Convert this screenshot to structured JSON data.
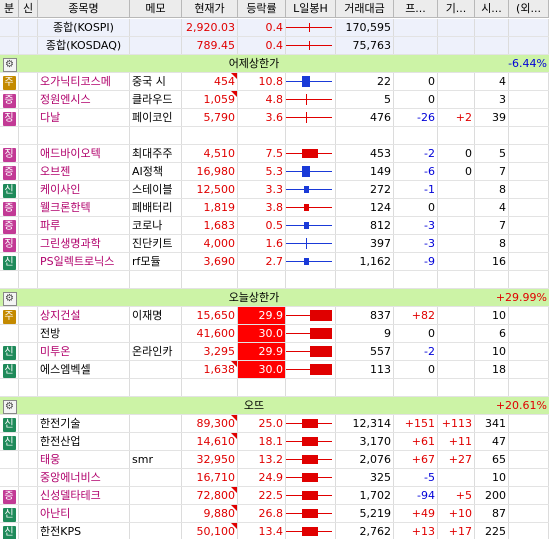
{
  "headers": [
    "분",
    "신",
    "종목명",
    "메모",
    "현재가",
    "등락률",
    "L일봉H",
    "거래대금",
    "프...",
    "기...",
    "시...",
    "(외..."
  ],
  "rows": [
    {
      "kind": "index",
      "name": "종합(KOSPI)",
      "price": "2,920.03",
      "rate": "0.4",
      "value": "170,595",
      "candle": {
        "body": "none",
        "wick": "red"
      }
    },
    {
      "kind": "index",
      "name": "종합(KOSDAQ)",
      "price": "789.45",
      "rate": "0.4",
      "value": "75,763",
      "candle": {
        "body": "none",
        "wick": "red"
      }
    },
    {
      "kind": "section",
      "title": "어제상한가",
      "change": "-6.44%",
      "change_color": "blue"
    },
    {
      "kind": "stock",
      "badge": "주",
      "name": "오가닉티코스메",
      "name_color": "pur",
      "memo": "중국 시",
      "price": "454",
      "rate": "10.8",
      "value": "22",
      "pro": "0",
      "gi": "",
      "si": "4",
      "flag": true,
      "candle": {
        "body": "blue",
        "wick": "blue"
      }
    },
    {
      "kind": "stock",
      "badge": "증",
      "name": "정원엔시스",
      "name_color": "pur",
      "memo": "클라우드",
      "price": "1,059",
      "rate": "4.8",
      "value": "5",
      "pro": "0",
      "gi": "",
      "si": "3",
      "flag": true,
      "candle": {
        "body": "tick",
        "wick": "red"
      }
    },
    {
      "kind": "stock",
      "badge": "징",
      "name": "다날",
      "name_color": "pur",
      "memo": "페이코인",
      "price": "5,790",
      "rate": "3.6",
      "value": "476",
      "pro": "-26",
      "gi": "+2",
      "si": "39",
      "flag": false,
      "candle": {
        "body": "tick",
        "wick": "red"
      }
    },
    {
      "kind": "blank"
    },
    {
      "kind": "stock",
      "badge": "징",
      "name": "애드바이오텍",
      "name_color": "pur",
      "memo": "최대주주",
      "price": "4,510",
      "rate": "7.5",
      "value": "453",
      "pro": "-2",
      "gi": "0",
      "si": "5",
      "flag": false,
      "candle": {
        "body": "red-long",
        "wick": "red"
      }
    },
    {
      "kind": "stock",
      "badge": "증",
      "name": "오브젠",
      "name_color": "pur",
      "memo": "AI정책",
      "price": "16,980",
      "rate": "5.3",
      "value": "149",
      "pro": "-6",
      "gi": "0",
      "si": "7",
      "flag": false,
      "candle": {
        "body": "blue",
        "wick": "blue"
      }
    },
    {
      "kind": "stock",
      "badge": "신",
      "name": "케이사인",
      "name_color": "pur",
      "memo": "스테이블",
      "price": "12,500",
      "rate": "3.3",
      "value": "272",
      "pro": "-1",
      "gi": "",
      "si": "8",
      "flag": false,
      "candle": {
        "body": "blue-small",
        "wick": "blue"
      }
    },
    {
      "kind": "stock",
      "badge": "증",
      "name": "웰크론한텍",
      "name_color": "pur",
      "memo": "페배터리",
      "price": "1,819",
      "rate": "3.8",
      "value": "124",
      "pro": "0",
      "gi": "",
      "si": "4",
      "flag": false,
      "candle": {
        "body": "red-small",
        "wick": "red"
      }
    },
    {
      "kind": "stock",
      "badge": "증",
      "name": "파루",
      "name_color": "pur",
      "memo": "코로나",
      "price": "1,683",
      "rate": "0.5",
      "value": "812",
      "pro": "-3",
      "gi": "",
      "si": "7",
      "flag": false,
      "candle": {
        "body": "blue-small",
        "wick": "blue"
      }
    },
    {
      "kind": "stock",
      "badge": "징",
      "name": "그린생명과학",
      "name_color": "pur",
      "memo": "진단키트",
      "price": "4,000",
      "rate": "1.6",
      "value": "397",
      "pro": "-3",
      "gi": "",
      "si": "8",
      "flag": false,
      "candle": {
        "body": "tick",
        "wick": "blue"
      }
    },
    {
      "kind": "stock",
      "badge": "신",
      "name": "PS일렉트로닉스",
      "name_color": "pur",
      "memo": "rf모듈",
      "price": "3,690",
      "rate": "2.7",
      "value": "1,162",
      "pro": "-9",
      "gi": "",
      "si": "16",
      "flag": false,
      "candle": {
        "body": "blue-small",
        "wick": "blue"
      }
    },
    {
      "kind": "blank"
    },
    {
      "kind": "section",
      "title": "오늘상한가",
      "change": "+29.99%",
      "change_color": "red"
    },
    {
      "kind": "stock",
      "badge": "주",
      "name": "상지건설",
      "name_color": "pur",
      "memo": "이재명",
      "price": "15,650",
      "rate": "29.9",
      "rate_hl": true,
      "value": "837",
      "pro": "+82",
      "gi": "",
      "si": "10",
      "flag": false,
      "candle": {
        "body": "red-full",
        "wick": "red"
      }
    },
    {
      "kind": "stock",
      "badge": "",
      "name": "전방",
      "name_color": "blk",
      "memo": "",
      "price": "41,600",
      "rate": "30.0",
      "rate_hl": true,
      "value": "9",
      "pro": "0",
      "gi": "",
      "si": "6",
      "flag": false,
      "candle": {
        "body": "red-full",
        "wick": "red"
      }
    },
    {
      "kind": "stock",
      "badge": "신",
      "name": "미투온",
      "name_color": "pur",
      "memo": "온라인카",
      "price": "3,295",
      "rate": "29.9",
      "rate_hl": true,
      "value": "557",
      "pro": "-2",
      "gi": "",
      "si": "10",
      "flag": false,
      "candle": {
        "body": "red-full",
        "wick": "red"
      }
    },
    {
      "kind": "stock",
      "badge": "신",
      "name": "에스엠벡셀",
      "name_color": "blk",
      "memo": "",
      "price": "1,638",
      "rate": "30.0",
      "rate_hl": true,
      "value": "113",
      "pro": "0",
      "gi": "",
      "si": "18",
      "flag": true,
      "candle": {
        "body": "red-full",
        "wick": "red"
      }
    },
    {
      "kind": "blank"
    },
    {
      "kind": "section",
      "title": "오뜨",
      "change": "+20.61%",
      "change_color": "red"
    },
    {
      "kind": "stock",
      "badge": "신",
      "name": "한전기술",
      "name_color": "blk",
      "memo": "",
      "price": "89,300",
      "rate": "25.0",
      "value": "12,314",
      "pro": "+151",
      "gi": "+113",
      "si": "341",
      "flag": true,
      "candle": {
        "body": "red-long",
        "wick": "red"
      }
    },
    {
      "kind": "stock",
      "badge": "신",
      "name": "한전산업",
      "name_color": "blk",
      "memo": "",
      "price": "14,610",
      "rate": "18.1",
      "value": "3,170",
      "pro": "+61",
      "gi": "+11",
      "si": "47",
      "flag": true,
      "candle": {
        "body": "red-long",
        "wick": "red"
      }
    },
    {
      "kind": "stock",
      "badge": "",
      "name": "태웅",
      "name_color": "pur",
      "memo": "smr",
      "price": "32,950",
      "rate": "13.2",
      "value": "2,076",
      "pro": "+67",
      "gi": "+27",
      "si": "65",
      "flag": false,
      "candle": {
        "body": "red-long",
        "wick": "red"
      }
    },
    {
      "kind": "stock",
      "badge": "",
      "name": "중앙에너비스",
      "name_color": "pur",
      "memo": "",
      "price": "16,710",
      "rate": "24.9",
      "value": "325",
      "pro": "-5",
      "gi": "",
      "si": "10",
      "flag": false,
      "candle": {
        "body": "red-long",
        "wick": "red"
      }
    },
    {
      "kind": "stock",
      "badge": "증",
      "name": "신성델타테크",
      "name_color": "pur",
      "memo": "",
      "price": "72,800",
      "rate": "22.5",
      "value": "1,702",
      "pro": "-94",
      "gi": "+5",
      "si": "200",
      "flag": true,
      "candle": {
        "body": "red-long",
        "wick": "red"
      }
    },
    {
      "kind": "stock",
      "badge": "신",
      "name": "아난티",
      "name_color": "pur",
      "memo": "",
      "price": "9,880",
      "rate": "26.8",
      "value": "5,219",
      "pro": "+49",
      "gi": "+10",
      "si": "87",
      "flag": true,
      "candle": {
        "body": "red-long",
        "wick": "red"
      }
    },
    {
      "kind": "stock",
      "badge": "신",
      "name": "한전KPS",
      "name_color": "blk",
      "memo": "",
      "price": "50,100",
      "rate": "13.4",
      "value": "2,762",
      "pro": "+13",
      "gi": "+17",
      "si": "225",
      "flag": true,
      "candle": {
        "body": "red-long",
        "wick": "red"
      }
    }
  ]
}
